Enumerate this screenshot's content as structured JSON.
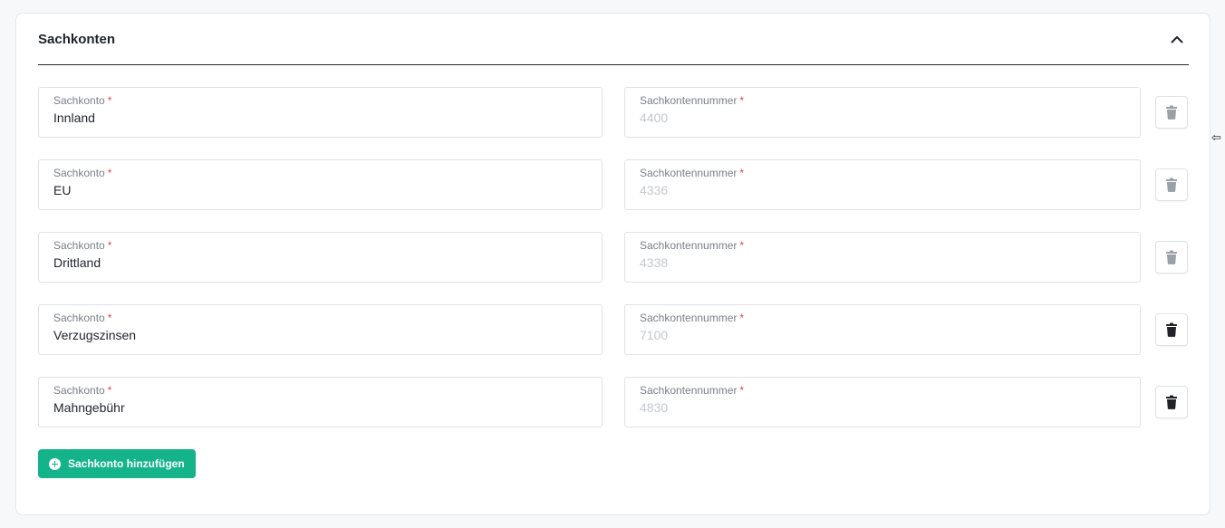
{
  "section": {
    "title": "Sachkonten",
    "collapse_icon": "chevron-up-icon"
  },
  "rows": [
    {
      "konto_label": "Sachkonto",
      "konto_value": "Innland",
      "nummer_label": "Sachkontennummer",
      "nummer_value": "4400",
      "delete_enabled": false
    },
    {
      "konto_label": "Sachkonto",
      "konto_value": "EU",
      "nummer_label": "Sachkontennummer",
      "nummer_value": "4336",
      "delete_enabled": false
    },
    {
      "konto_label": "Sachkonto",
      "konto_value": "Drittland",
      "nummer_label": "Sachkontennummer",
      "nummer_value": "4338",
      "delete_enabled": false
    },
    {
      "konto_label": "Sachkonto",
      "konto_value": "Verzugszinsen",
      "nummer_label": "Sachkontennummer",
      "nummer_value": "7100",
      "delete_enabled": true
    },
    {
      "konto_label": "Sachkonto",
      "konto_value": "Mahngebühr",
      "nummer_label": "Sachkontennummer",
      "nummer_value": "4830",
      "delete_enabled": true
    }
  ],
  "required_marker": "*",
  "add_button": {
    "label": "Sachkonto hinzufügen",
    "icon": "plus-circle-icon"
  },
  "colors": {
    "accent": "#14b38a",
    "required": "#e5484d",
    "delete_disabled": "#9aa0a8",
    "delete_enabled": "#1f2329"
  }
}
